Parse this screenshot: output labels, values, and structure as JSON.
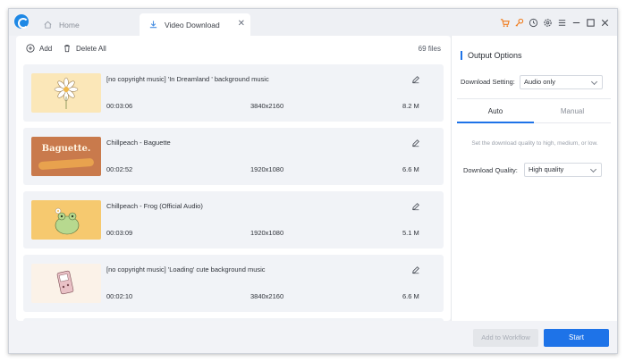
{
  "tabs": [
    {
      "label": "Home",
      "icon": "home-icon"
    },
    {
      "label": "Video Download",
      "icon": "download-icon"
    }
  ],
  "toolbar": {
    "add_label": "Add",
    "delete_all_label": "Delete All",
    "file_count": "69 files"
  },
  "files": [
    {
      "title": "[no copyright music] 'In Dreamland ' background music",
      "duration": "00:03:06",
      "resolution": "3840x2160",
      "size": "8.2 M"
    },
    {
      "title": "Chillpeach - Baguette",
      "duration": "00:02:52",
      "resolution": "1920x1080",
      "size": "6.6 M",
      "thumb_text": "Baguette."
    },
    {
      "title": "Chillpeach - Frog (Official Audio)",
      "duration": "00:03:09",
      "resolution": "1920x1080",
      "size": "5.1 M"
    },
    {
      "title": "[no copyright music] 'Loading' cute background music",
      "duration": "00:02:10",
      "resolution": "3840x2160",
      "size": "6.6 M"
    }
  ],
  "options": {
    "title": "Output Options",
    "download_setting_label": "Download Setting:",
    "download_setting_value": "Audio only",
    "tab_auto": "Auto",
    "tab_manual": "Manual",
    "auto_description": "Set the download quality to high, medium, or low.",
    "quality_label": "Download Quality:",
    "quality_value": "High quality"
  },
  "footer": {
    "workflow_label": "Add to Workflow",
    "start_label": "Start"
  },
  "colors": {
    "accent": "#1e73e8",
    "cart": "#f07a1a",
    "key": "#f07a1a"
  }
}
